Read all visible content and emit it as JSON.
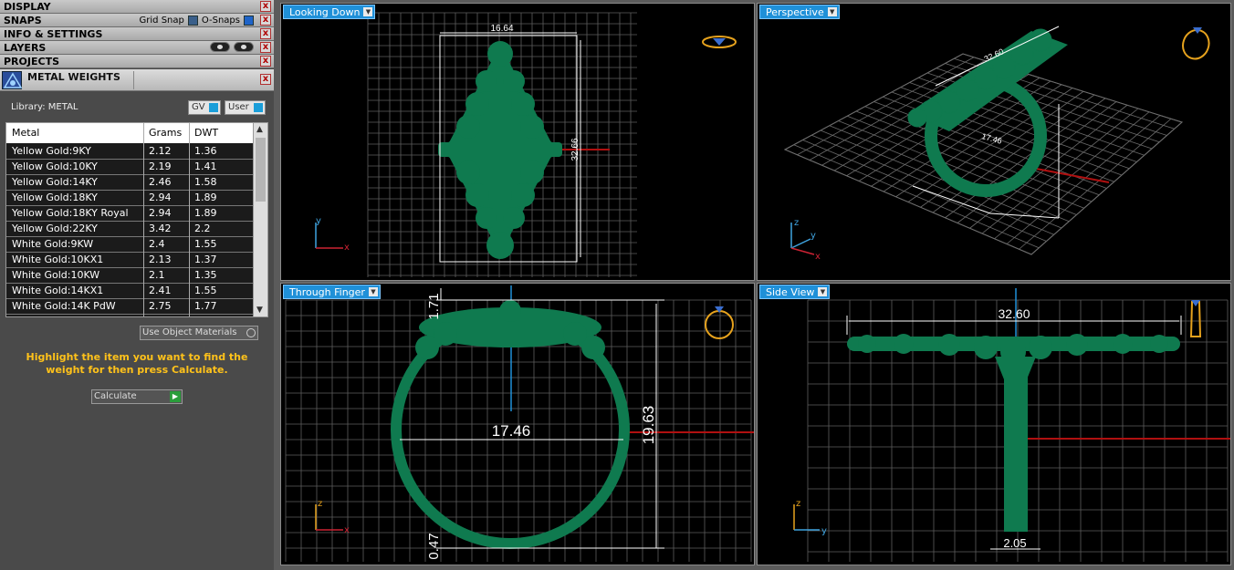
{
  "panel": {
    "sections": [
      {
        "label": "DISPLAY"
      },
      {
        "label": "SNAPS"
      },
      {
        "label": "INFO & SETTINGS"
      },
      {
        "label": "LAYERS"
      },
      {
        "label": "PROJECTS"
      }
    ],
    "snaps": {
      "grid_snap": "Grid Snap",
      "o_snaps": "O-Snaps"
    },
    "close_glyph": "x"
  },
  "metal_weights": {
    "title": "METAL WEIGHTS",
    "library_label": "Library: METAL",
    "gv_label": "GV",
    "user_label": "User",
    "columns": [
      "Metal",
      "Grams",
      "DWT"
    ],
    "rows": [
      [
        "Yellow Gold:9KY",
        "2.12",
        "1.36"
      ],
      [
        "Yellow Gold:10KY",
        "2.19",
        "1.41"
      ],
      [
        "Yellow Gold:14KY",
        "2.46",
        "1.58"
      ],
      [
        "Yellow Gold:18KY",
        "2.94",
        "1.89"
      ],
      [
        "Yellow Gold:18KY Royal",
        "2.94",
        "1.89"
      ],
      [
        "Yellow Gold:22KY",
        "3.42",
        "2.2"
      ],
      [
        "White Gold:9KW",
        "2.4",
        "1.55"
      ],
      [
        "White Gold:10KX1",
        "2.13",
        "1.37"
      ],
      [
        "White Gold:10KW",
        "2.1",
        "1.35"
      ],
      [
        "White Gold:14KX1",
        "2.41",
        "1.55"
      ],
      [
        "White Gold:14K PdW",
        "2.75",
        "1.77"
      ]
    ],
    "use_object_materials": "Use Object Materials",
    "hint": "Highlight the item you want to find the weight for then press Calculate.",
    "calculate": "Calculate"
  },
  "viewports": {
    "top": {
      "label": "Looking Down",
      "dim_width": "16.64",
      "dim_height": "32.66"
    },
    "persp": {
      "label": "Perspective",
      "dim_a": "32.60",
      "dim_b": "17.46"
    },
    "front": {
      "label": "Through Finger",
      "dim_top": "1.71",
      "dim_diameter": "17.46",
      "dim_height": "19.63",
      "dim_bottom": "0.47"
    },
    "side": {
      "label": "Side View",
      "dim_width": "32.60",
      "dim_shank": "2.05"
    }
  },
  "axes": {
    "x": "x",
    "y": "y",
    "z": "z"
  },
  "colors": {
    "model": "#0f7a4f",
    "grid": "#5e5e5e",
    "accent": "#1f90d8",
    "hint": "#ffc21a"
  }
}
